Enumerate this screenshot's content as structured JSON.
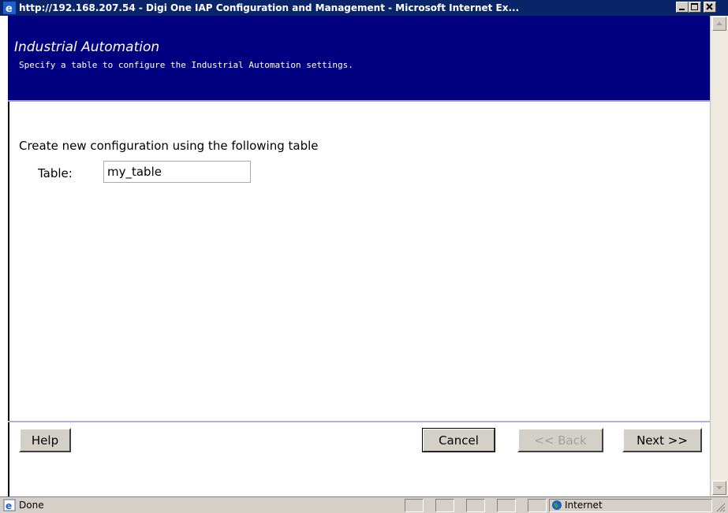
{
  "window": {
    "title": "http://192.168.207.54 - Digi One IAP Configuration and Management - Microsoft Internet Ex...",
    "controls": [
      "minimize-icon",
      "maximize-icon",
      "close-icon"
    ]
  },
  "banner": {
    "title": "Industrial Automation",
    "subtitle": "Specify a table to configure the Industrial Automation settings."
  },
  "form": {
    "intro": "Create new configuration using the following table",
    "table_label": "Table:",
    "table_value": "my_table"
  },
  "buttons": {
    "help": "Help",
    "cancel": "Cancel",
    "back": "<< Back",
    "next": "Next >>"
  },
  "status": {
    "text": "Done",
    "zone": "Internet"
  },
  "colors": {
    "titlebar": "#0a246a",
    "banner": "#000080",
    "chrome": "#d4d0c8"
  }
}
